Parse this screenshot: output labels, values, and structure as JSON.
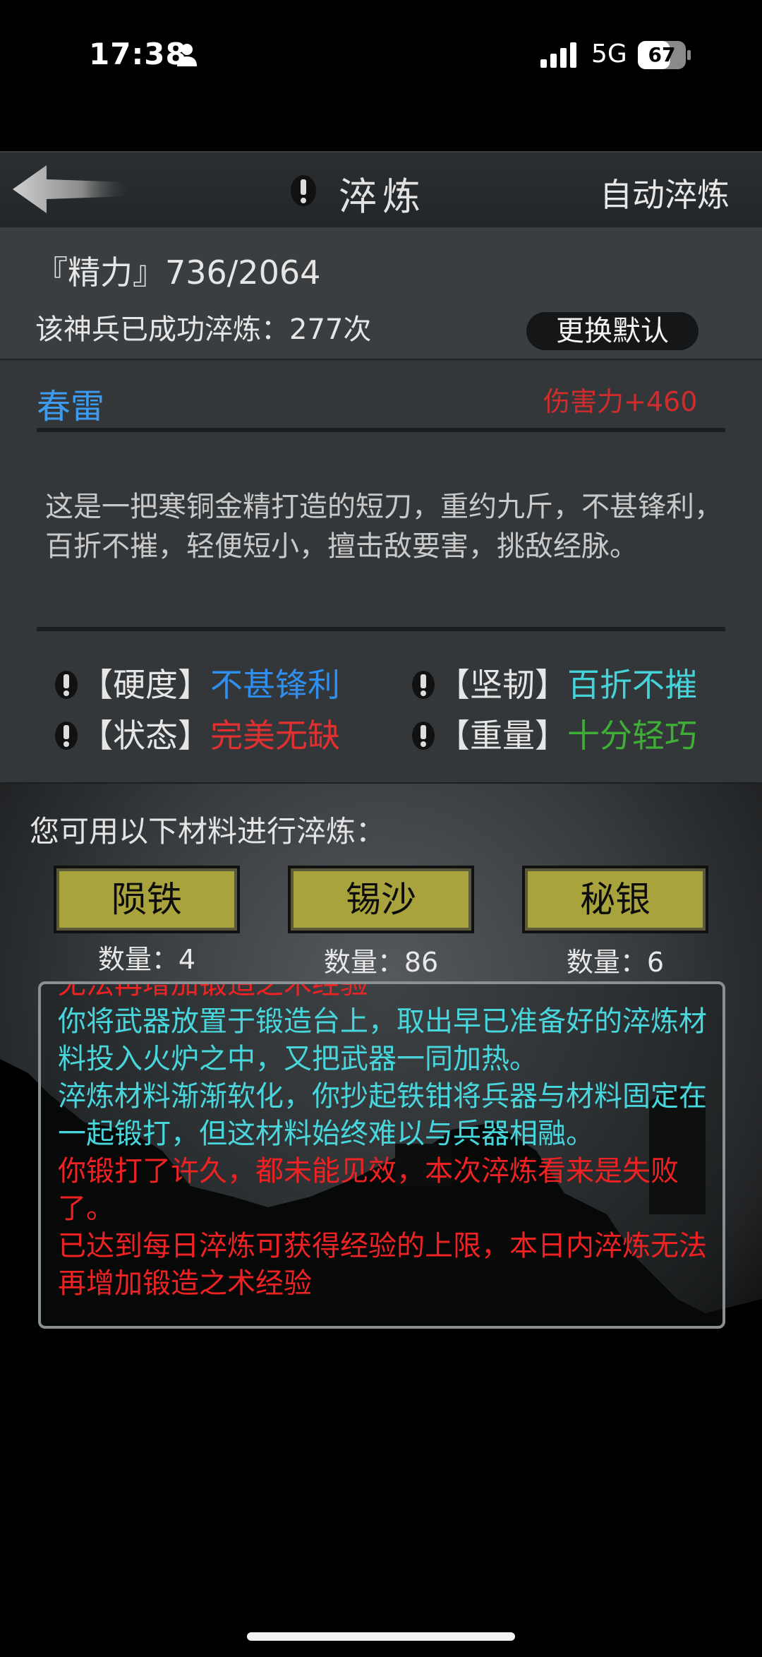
{
  "status_bar": {
    "time": "17:38",
    "network": "5G",
    "battery": "67",
    "battery_level": 0.67
  },
  "header": {
    "title": "淬炼",
    "auto_button": "自动淬炼",
    "icons": [
      "back-arrow-icon",
      "warning-icon"
    ]
  },
  "stats": {
    "energy": "『精力』736/2064",
    "forge_count": "该神兵已成功淬炼：277次",
    "switch_default_button": "更换默认"
  },
  "weapon": {
    "name": "春雷",
    "damage": "伤害力+460",
    "description": "这是一把寒铜金精打造的短刀，重约九斤，不甚锋利，百折不摧，轻便短小，擅击敌要害，挑敌经脉。",
    "attributes": [
      {
        "label": "【硬度】",
        "value": "不甚锋利",
        "color": "#2e8ff0"
      },
      {
        "label": "【坚韧】",
        "value": "百折不摧",
        "color": "#44d3d8"
      },
      {
        "label": "【状态】",
        "value": "完美无缺",
        "color": "#e03030"
      },
      {
        "label": "【重量】",
        "value": "十分轻巧",
        "color": "#3fae36"
      }
    ]
  },
  "materials": {
    "prompt": "您可用以下材料进行淬炼：",
    "items": [
      {
        "name": "陨铁",
        "count": "数量：4"
      },
      {
        "name": "锡沙",
        "count": "数量：86"
      },
      {
        "name": "秘银",
        "count": "数量：6"
      }
    ]
  },
  "log": [
    {
      "text": "无法再增加锻造之术经验",
      "color": "red"
    },
    {
      "text": "你将武器放置于锻造台上，取出早已准备好的淬炼材料投入火炉之中，又把武器一同加热。",
      "color": "cyan"
    },
    {
      "text": "淬炼材料渐渐软化，你抄起铁钳将兵器与材料固定在一起锻打，但这材料始终难以与兵器相融。",
      "color": "cyan"
    },
    {
      "text": "你锻打了许久，都未能见效，本次淬炼看来是失败了。",
      "color": "red"
    },
    {
      "text": "已达到每日淬炼可获得经验的上限，本日内淬炼无法再增加锻造之术经验",
      "color": "red"
    }
  ]
}
